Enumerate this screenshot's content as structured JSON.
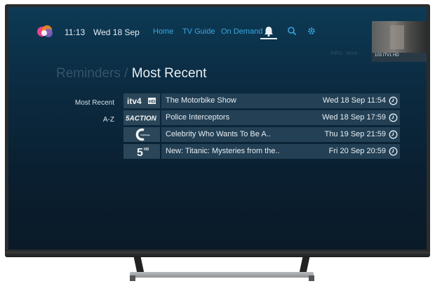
{
  "header": {
    "time": "11:13",
    "date": "Wed 18 Sep",
    "nav": {
      "home": "Home",
      "tv_guide": "TV Guide",
      "on_demand": "On Demand"
    },
    "active_tab_icon": "bell-icon",
    "preview_caption": "103 ITV1 HD",
    "info_hint": "INFO : More"
  },
  "page": {
    "breadcrumb_parent": "Reminders /",
    "title": "Most Recent"
  },
  "sidebar": {
    "items": [
      {
        "label": "Most Recent"
      },
      {
        "label": "A-Z"
      }
    ]
  },
  "reminders": [
    {
      "channel_logo": "itv4-hd-logo",
      "channel_text": "itv4 HD",
      "title": "The Motorbike Show",
      "when": "Wed 18 Sep 11:54"
    },
    {
      "channel_logo": "5action-logo",
      "channel_text": "5ACTION",
      "title": "Police Interceptors",
      "when": "Wed 18 Sep 17:59"
    },
    {
      "channel_logo": "challenge-logo",
      "channel_text": "challenge",
      "title": "Celebrity Who Wants To Be A..",
      "when": "Thu 19 Sep 21:59"
    },
    {
      "channel_logo": "5hd-logo",
      "channel_text": "5HD",
      "title": "New: Titanic: Mysteries from the..",
      "when": "Fri 20 Sep 20:59"
    }
  ],
  "colors": {
    "accent": "#3aa6e0",
    "row_bg": "#234055",
    "screen_bg": "#0b2a40"
  }
}
